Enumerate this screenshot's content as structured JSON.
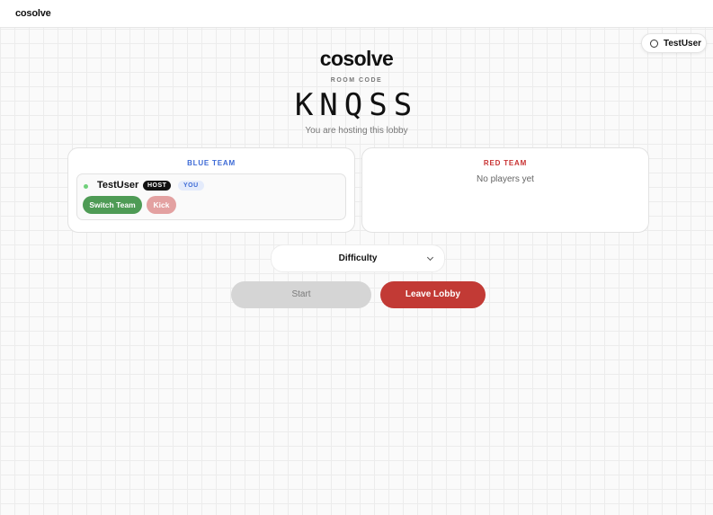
{
  "topbar": {
    "brand": "cosolve"
  },
  "user_chip": {
    "name": "TestUser"
  },
  "header": {
    "logo": "cosolve",
    "room_label": "ROOM CODE",
    "room_code": "KNQSS",
    "hosting_text": "You are hosting this lobby"
  },
  "teams": {
    "blue": {
      "title": "BLUE TEAM",
      "color": "#3d6ad6",
      "players": [
        {
          "name": "TestUser",
          "host_badge": "HOST",
          "you_badge": "YOU",
          "switch_label": "Switch Team",
          "kick_label": "Kick"
        }
      ]
    },
    "red": {
      "title": "RED TEAM",
      "color": "#c83232",
      "empty_text": "No players yet"
    }
  },
  "difficulty": {
    "selected": "Difficulty"
  },
  "actions": {
    "start_label": "Start",
    "leave_label": "Leave Lobby"
  },
  "colors": {
    "switch_button": "#4e9b55",
    "kick_button": "#e3a1a1",
    "leave_button": "#c23a35",
    "start_disabled": "#d5d5d5",
    "online_dot": "#6fd07a"
  }
}
